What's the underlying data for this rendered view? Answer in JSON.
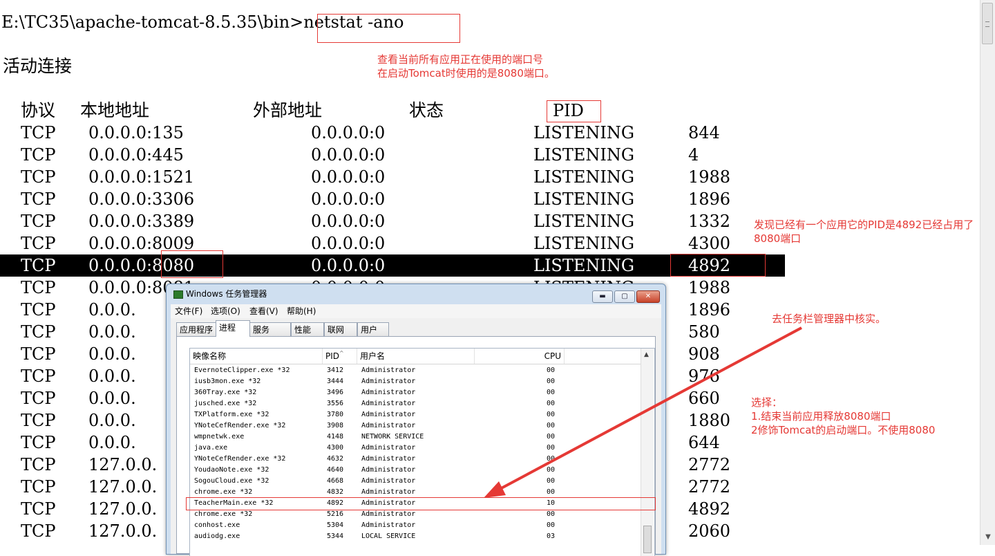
{
  "console": {
    "prompt": "E:\\TC35\\apache-tomcat-8.5.35\\bin>",
    "command": "netstat -ano",
    "heading": "活动连接",
    "headers": {
      "proto": "协议",
      "local": "本地地址",
      "foreign": "外部地址",
      "state": "状态",
      "pid": "PID"
    },
    "rows": [
      {
        "proto": "TCP",
        "local": "0.0.0.0:135",
        "foreign": "0.0.0.0:0",
        "state": "LISTENING",
        "pid": "844"
      },
      {
        "proto": "TCP",
        "local": "0.0.0.0:445",
        "foreign": "0.0.0.0:0",
        "state": "LISTENING",
        "pid": "4"
      },
      {
        "proto": "TCP",
        "local": "0.0.0.0:1521",
        "foreign": "0.0.0.0:0",
        "state": "LISTENING",
        "pid": "1988"
      },
      {
        "proto": "TCP",
        "local": "0.0.0.0:3306",
        "foreign": "0.0.0.0:0",
        "state": "LISTENING",
        "pid": "1896"
      },
      {
        "proto": "TCP",
        "local": "0.0.0.0:3389",
        "foreign": "0.0.0.0:0",
        "state": "LISTENING",
        "pid": "1332"
      },
      {
        "proto": "TCP",
        "local": "0.0.0.0:8009",
        "foreign": "0.0.0.0:0",
        "state": "LISTENING",
        "pid": "4300"
      },
      {
        "proto": "TCP",
        "local": "0.0.0.0:8080",
        "foreign": "0.0.0.0:0",
        "state": "LISTENING",
        "pid": "4892"
      },
      {
        "proto": "TCP",
        "local": "0.0.0.0:8081",
        "foreign": "0.0.0.0:0",
        "state": "LISTENING",
        "pid": "1988"
      },
      {
        "proto": "TCP",
        "local": "0.0.0.",
        "foreign": "",
        "state": "",
        "pid": "1896"
      },
      {
        "proto": "TCP",
        "local": "0.0.0.",
        "foreign": "",
        "state": "",
        "pid": "580"
      },
      {
        "proto": "TCP",
        "local": "0.0.0.",
        "foreign": "",
        "state": "",
        "pid": "908"
      },
      {
        "proto": "TCP",
        "local": "0.0.0.",
        "foreign": "",
        "state": "",
        "pid": "976"
      },
      {
        "proto": "TCP",
        "local": "0.0.0.",
        "foreign": "",
        "state": "",
        "pid": "660"
      },
      {
        "proto": "TCP",
        "local": "0.0.0.",
        "foreign": "",
        "state": "",
        "pid": "1880"
      },
      {
        "proto": "TCP",
        "local": "0.0.0.",
        "foreign": "",
        "state": "",
        "pid": "644"
      },
      {
        "proto": "TCP",
        "local": "127.0.0.",
        "foreign": "",
        "state": "",
        "pid": "2772"
      },
      {
        "proto": "TCP",
        "local": "127.0.0.",
        "foreign": "",
        "state": "",
        "pid": "2772"
      },
      {
        "proto": "TCP",
        "local": "127.0.0.",
        "foreign": "",
        "state": "",
        "pid": "4892"
      },
      {
        "proto": "TCP",
        "local": "127.0.0.",
        "foreign": "",
        "state": "",
        "pid": "2060"
      }
    ],
    "highlight_row_index": 6
  },
  "annotations": {
    "note1": "查看当前所有应用正在使用的端口号\n在启动Tomcat时使用的是8080端口。",
    "note2": "发现已经有一个应用它的PID是4892已经占用了\n8080端口",
    "note3": "去任务栏管理器中核实。",
    "note4": "选择：\n1.结束当前应用释放8080端口\n2修饰Tomcat的启动端口。不使用8080",
    "color": "#e53935"
  },
  "task_manager": {
    "title": "Windows 任务管理器",
    "controls": {
      "minimize": "▬",
      "maximize": "▢",
      "close": "✕"
    },
    "menu": [
      "文件(F)",
      "选项(O)",
      "查看(V)",
      "帮助(H)"
    ],
    "tabs": [
      "应用程序",
      "进程",
      "服务",
      "性能",
      "联网",
      "用户"
    ],
    "active_tab": "进程",
    "columns": {
      "name": "映像名称",
      "pid": "PID",
      "user": "用户名",
      "cpu": "CPU"
    },
    "sort_indicator": "^",
    "processes": [
      {
        "name": "EvernoteClipper.exe *32",
        "pid": "3412",
        "user": "Administrator",
        "cpu": "00"
      },
      {
        "name": "iusb3mon.exe *32",
        "pid": "3444",
        "user": "Administrator",
        "cpu": "00"
      },
      {
        "name": "360Tray.exe *32",
        "pid": "3496",
        "user": "Administrator",
        "cpu": "00"
      },
      {
        "name": "jusched.exe *32",
        "pid": "3556",
        "user": "Administrator",
        "cpu": "00"
      },
      {
        "name": "TXPlatform.exe *32",
        "pid": "3780",
        "user": "Administrator",
        "cpu": "00"
      },
      {
        "name": "YNoteCefRender.exe *32",
        "pid": "3908",
        "user": "Administrator",
        "cpu": "00"
      },
      {
        "name": "wmpnetwk.exe",
        "pid": "4148",
        "user": "NETWORK SERVICE",
        "cpu": "00"
      },
      {
        "name": "java.exe",
        "pid": "4300",
        "user": "Administrator",
        "cpu": "00"
      },
      {
        "name": "YNoteCefRender.exe *32",
        "pid": "4632",
        "user": "Administrator",
        "cpu": "00"
      },
      {
        "name": "YoudaoNote.exe *32",
        "pid": "4640",
        "user": "Administrator",
        "cpu": "00"
      },
      {
        "name": "SogouCloud.exe *32",
        "pid": "4668",
        "user": "Administrator",
        "cpu": "00"
      },
      {
        "name": "chrome.exe *32",
        "pid": "4832",
        "user": "Administrator",
        "cpu": "00"
      },
      {
        "name": "TeacherMain.exe *32",
        "pid": "4892",
        "user": "Administrator",
        "cpu": "10"
      },
      {
        "name": "chrome.exe *32",
        "pid": "5216",
        "user": "Administrator",
        "cpu": "00"
      },
      {
        "name": "conhost.exe",
        "pid": "5304",
        "user": "Administrator",
        "cpu": "00"
      },
      {
        "name": "audiodg.exe",
        "pid": "5344",
        "user": "LOCAL SERVICE",
        "cpu": "03"
      }
    ],
    "highlight_process_index": 12
  },
  "scrollbar": {
    "up": "▲",
    "down": "▼"
  }
}
